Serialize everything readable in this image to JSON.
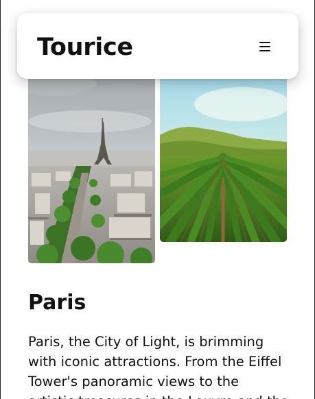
{
  "brand": {
    "name": "Tourice"
  },
  "header": {
    "menu_icon": "hamburger-menu-icon"
  },
  "gallery": {
    "images": [
      {
        "subject": "Paris cityscape with Eiffel Tower"
      },
      {
        "subject": "Vineyard rows with green hills"
      }
    ]
  },
  "destination": {
    "title": "Paris",
    "description": "Paris, the City of Light, is brimming with iconic attractions. From the Eiffel Tower's panoramic views to the artistic treasures in the Louvre and the"
  },
  "colors": {
    "text": "#111111",
    "background": "#ffffff",
    "card": "#ffffff"
  }
}
